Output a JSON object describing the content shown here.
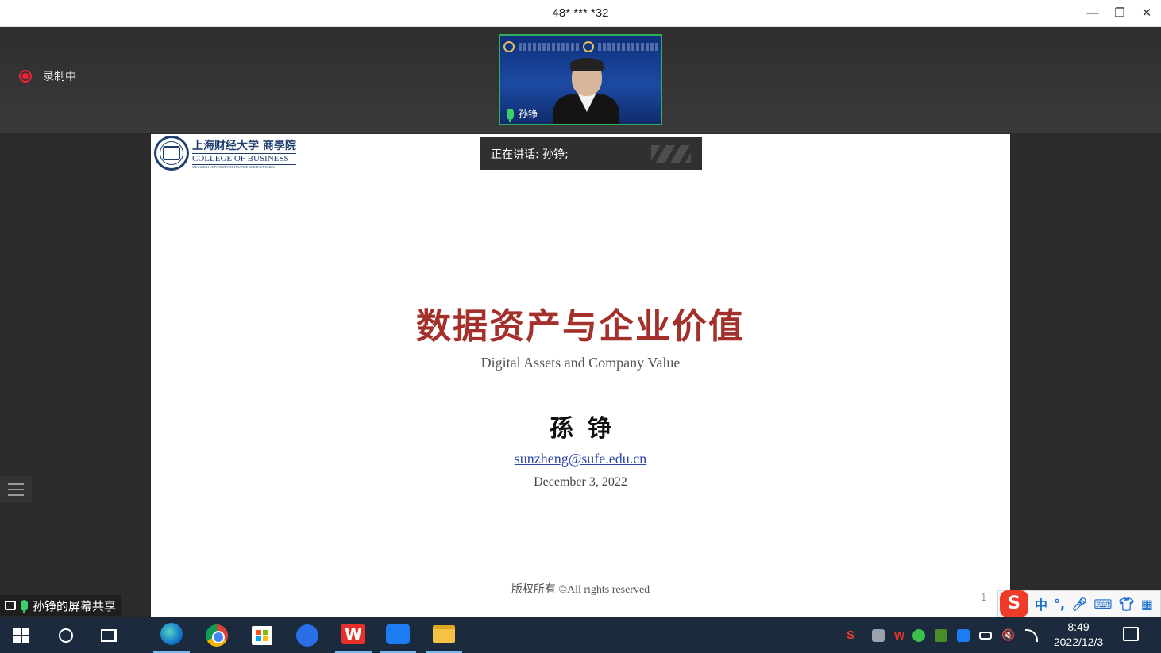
{
  "window": {
    "title": "48* *** *32",
    "min_icon": "—",
    "max_icon": "❐",
    "close_icon": "✕"
  },
  "meeting": {
    "recording_label": "录制中",
    "speaker_tile_name": "孙铮",
    "speaking_label": "正在讲话: 孙铮;",
    "screen_share_label": "孙铮的屏幕共享"
  },
  "slide": {
    "logo_cn": "上海财经大学 商學院",
    "logo_en": "COLLEGE OF BUSINESS",
    "logo_sub": "SHANGHAI UNIVERSITY OF FINANCE AND ECONOMICS",
    "title": "数据资产与企业价值",
    "subtitle": "Digital Assets and Company Value",
    "author": "孫铮",
    "email": "sunzheng@sufe.edu.cn",
    "date": "December 3, 2022",
    "copyright": "版权所有 ©All rights reserved",
    "page_number": "1"
  },
  "ime": {
    "logo": "S",
    "lang": "中",
    "punct": "°,",
    "mic_icon": "mic-icon",
    "keyboard_icon": "keyboard-icon",
    "skin_icon": "shirt-icon",
    "grid_icon": "grid-icon"
  },
  "taskbar": {
    "wps_label": "W",
    "tray_sogou": "S",
    "tray_wps": "W",
    "volume_icon": "🔇",
    "time": "8:49",
    "date": "2022/12/3"
  }
}
